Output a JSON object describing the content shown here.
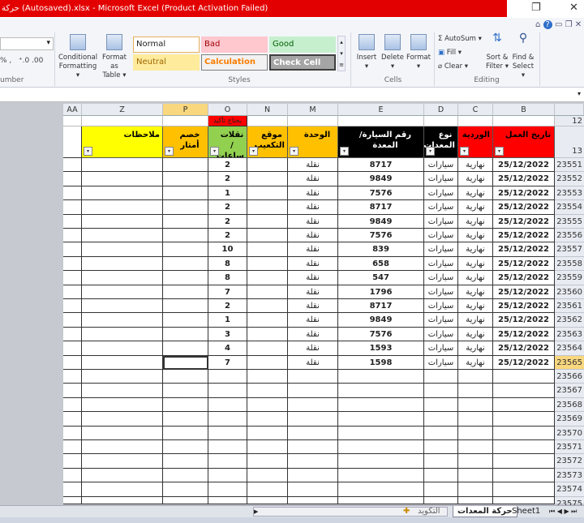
{
  "window": {
    "title": "حركة (Autosaved).xlsx - Microsoft Excel (Product Activation Failed)"
  },
  "ribbon": {
    "number_group": "umber",
    "conditional_formatting": [
      "Conditional",
      "Formatting ▾"
    ],
    "format_as_table": [
      "Format as",
      "Table ▾"
    ],
    "styles": {
      "normal": "Normal",
      "bad": "Bad",
      "good": "Good",
      "neutral": "Neutral",
      "calculation": "Calculation",
      "check_cell": "Check Cell",
      "label": "Styles"
    },
    "cells": {
      "insert": "Insert",
      "delete": "Delete",
      "format": "Format",
      "label": "Cells"
    },
    "editing": {
      "autosum": "AutoSum ▾",
      "fill": "Fill ▾",
      "clear": "Clear ▾",
      "sort": [
        "Sort &",
        "Filter ▾"
      ],
      "find": [
        "Find &",
        "Select ▾"
      ],
      "label": "Editing"
    },
    "colors": {
      "normal": "#ffffff",
      "bad": "#ffc7ce",
      "good": "#c6efce",
      "neutral": "#ffeb9c",
      "calculation": "#f2f2f2",
      "check_cell": "#a5a5a5"
    }
  },
  "sheet": {
    "columns": [
      "AA",
      "Z",
      "P",
      "O",
      "N",
      "M",
      "E",
      "D",
      "C",
      "B"
    ],
    "row12_label": "12",
    "row13_label": "13",
    "note_o12": "يحتاج تأكيد",
    "headers": [
      {
        "col": "Z",
        "text": "ملاحظات",
        "bg": "#ffff00",
        "color": "#000"
      },
      {
        "col": "P",
        "text": "خصم أمتار",
        "bg": "#ffc000",
        "color": "#000"
      },
      {
        "col": "O",
        "text": "نقلات /ساعات",
        "bg": "#92d050",
        "color": "#000"
      },
      {
        "col": "N",
        "text": "موقع التكعيب",
        "bg": "#ffc000",
        "color": "#000"
      },
      {
        "col": "M",
        "text": "الوحدة",
        "bg": "#ffc000",
        "color": "#000"
      },
      {
        "col": "E",
        "text": "رقم السيارة/المعدة",
        "bg": "#000000",
        "color": "#fff"
      },
      {
        "col": "D",
        "text": "نوع المعدات",
        "bg": "#000000",
        "color": "#fff"
      },
      {
        "col": "C",
        "text": "الوردية",
        "bg": "#ff0000",
        "color": "#000"
      },
      {
        "col": "B",
        "text": "تاريخ العمل",
        "bg": "#ff0000",
        "color": "#000"
      }
    ],
    "rows": [
      {
        "row": "23551",
        "date": "25/12/2022",
        "shift": "نهارية",
        "type": "سيارات",
        "vehicle": "8717",
        "unit": "نقلة",
        "trips": "2"
      },
      {
        "row": "23552",
        "date": "25/12/2022",
        "shift": "نهارية",
        "type": "سيارات",
        "vehicle": "9849",
        "unit": "نقلة",
        "trips": "2"
      },
      {
        "row": "23553",
        "date": "25/12/2022",
        "shift": "نهارية",
        "type": "سيارات",
        "vehicle": "7576",
        "unit": "نقلة",
        "trips": "1"
      },
      {
        "row": "23554",
        "date": "25/12/2022",
        "shift": "نهارية",
        "type": "سيارات",
        "vehicle": "8717",
        "unit": "نقلة",
        "trips": "2"
      },
      {
        "row": "23555",
        "date": "25/12/2022",
        "shift": "نهارية",
        "type": "سيارات",
        "vehicle": "9849",
        "unit": "نقلة",
        "trips": "2"
      },
      {
        "row": "23556",
        "date": "25/12/2022",
        "shift": "نهارية",
        "type": "سيارات",
        "vehicle": "7576",
        "unit": "نقلة",
        "trips": "2"
      },
      {
        "row": "23557",
        "date": "25/12/2022",
        "shift": "نهارية",
        "type": "سيارات",
        "vehicle": "839",
        "unit": "نقلة",
        "trips": "10"
      },
      {
        "row": "23558",
        "date": "25/12/2022",
        "shift": "نهارية",
        "type": "سيارات",
        "vehicle": "658",
        "unit": "نقلة",
        "trips": "8"
      },
      {
        "row": "23559",
        "date": "25/12/2022",
        "shift": "نهارية",
        "type": "سيارات",
        "vehicle": "547",
        "unit": "نقلة",
        "trips": "8"
      },
      {
        "row": "23560",
        "date": "25/12/2022",
        "shift": "نهارية",
        "type": "سيارات",
        "vehicle": "1796",
        "unit": "نقلة",
        "trips": "7"
      },
      {
        "row": "23561",
        "date": "25/12/2022",
        "shift": "نهارية",
        "type": "سيارات",
        "vehicle": "8717",
        "unit": "نقلة",
        "trips": "2"
      },
      {
        "row": "23562",
        "date": "25/12/2022",
        "shift": "نهارية",
        "type": "سيارات",
        "vehicle": "9849",
        "unit": "نقلة",
        "trips": "1"
      },
      {
        "row": "23563",
        "date": "25/12/2022",
        "shift": "نهارية",
        "type": "سيارات",
        "vehicle": "7576",
        "unit": "نقلة",
        "trips": "3"
      },
      {
        "row": "23564",
        "date": "25/12/2022",
        "shift": "نهارية",
        "type": "سيارات",
        "vehicle": "1593",
        "unit": "نقلة",
        "trips": "4"
      },
      {
        "row": "23565",
        "date": "25/12/2022",
        "shift": "نهارية",
        "type": "سيارات",
        "vehicle": "1598",
        "unit": "نقلة",
        "trips": "7"
      }
    ],
    "empty_rows": [
      "23566",
      "23567",
      "23568",
      "23569",
      "23570",
      "23571",
      "23572",
      "23573",
      "23574",
      "23575"
    ],
    "selected_row": "23565"
  },
  "tabs": [
    "Sheet1",
    "حركة المعدات",
    "التكويد"
  ],
  "active_tab": "حركة المعدات"
}
